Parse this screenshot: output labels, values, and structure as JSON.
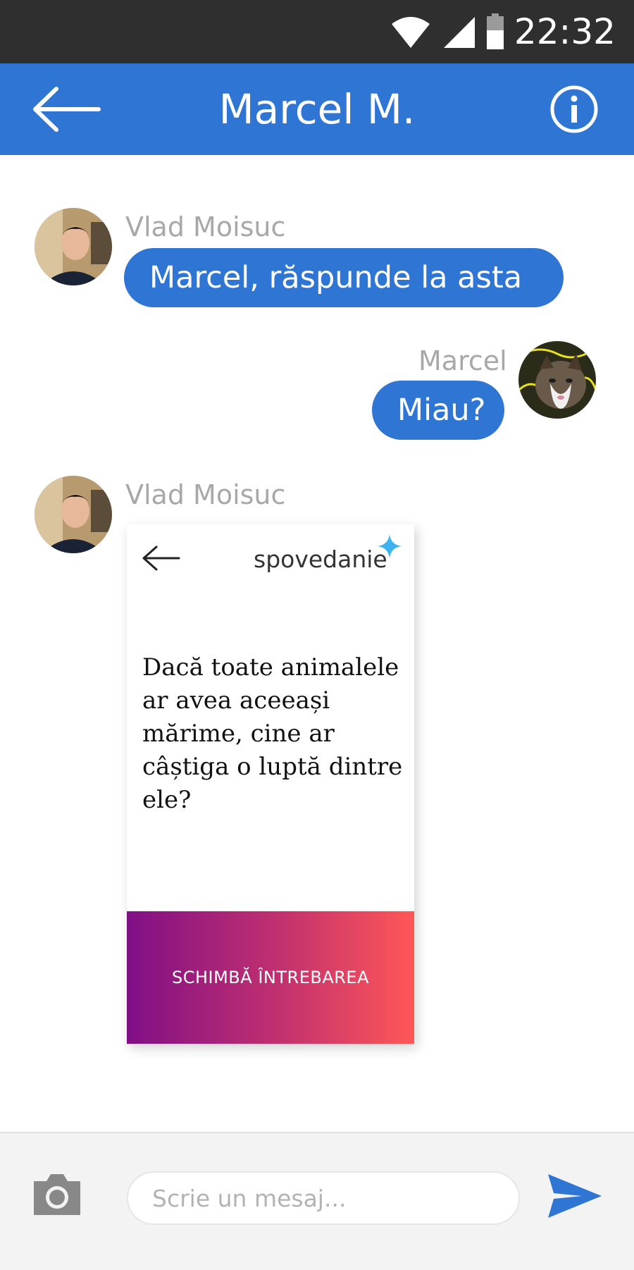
{
  "status_bar": {
    "time": "22:32"
  },
  "header": {
    "title": "Marcel M."
  },
  "messages": [
    {
      "sender": "Vlad Moisuc",
      "text": "Marcel, răspunde la asta",
      "side": "left"
    },
    {
      "sender": "Marcel",
      "text": "Miau?",
      "side": "right"
    },
    {
      "sender": "Vlad Moisuc",
      "side": "left",
      "card": {
        "brand": "spovedanie",
        "question": "Dacă toate animalele ar avea aceeași mărime, cine ar câștiga o luptă dintre ele?",
        "button_label": "SCHIMBĂ ÎNTREBAREA"
      }
    }
  ],
  "composer": {
    "placeholder": "Scrie un mesaj..."
  },
  "colors": {
    "primary": "#2e75d4",
    "status_bar": "#2f2f2f",
    "gradient_start": "#800f86",
    "gradient_end": "#ff5757",
    "brand_star": "#3fb3f0"
  },
  "icons": [
    "back-arrow-icon",
    "info-icon",
    "camera-icon",
    "send-icon",
    "wifi-icon",
    "signal-icon",
    "battery-icon"
  ]
}
